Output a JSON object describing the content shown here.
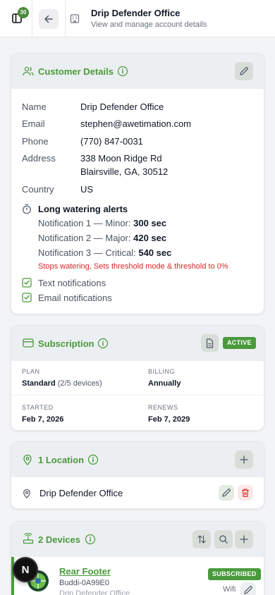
{
  "topbar": {
    "badge_count": "30",
    "title": "Drip Defender Office",
    "subtitle": "View and manage account details"
  },
  "customer": {
    "title": "Customer Details",
    "fields": {
      "name_label": "Name",
      "name_value": "Drip Defender Office",
      "email_label": "Email",
      "email_value": "stephen@awetimation.com",
      "phone_label": "Phone",
      "phone_value": "(770) 847-0031",
      "address_label": "Address",
      "address_line1": "338 Moon Ridge Rd",
      "address_line2": "Blairsville, GA, 30512",
      "country_label": "Country",
      "country_value": "US"
    },
    "alerts": {
      "title": "Long watering alerts",
      "n1_label": "Notification 1 — Minor:",
      "n1_value": "300 sec",
      "n2_label": "Notification 2 — Major:",
      "n2_value": "420 sec",
      "n3_label": "Notification 3 — Critical:",
      "n3_value": "540 sec",
      "warning": "Stops watering, Sets threshold mode & threshold to 0%"
    },
    "text_notifications": "Text notifications",
    "email_notifications": "Email notifications"
  },
  "subscription": {
    "title": "Subscription",
    "status": "ACTIVE",
    "plan_label": "PLAN",
    "plan_value": "Standard",
    "plan_devices": "(2/5 devices)",
    "billing_label": "BILLING",
    "billing_value": "Annually",
    "started_label": "STARTED",
    "started_value": "Feb 7, 2026",
    "renews_label": "RENEWS",
    "renews_value": "Feb 7, 2029"
  },
  "locations": {
    "title": "1 Location",
    "items": [
      {
        "name": "Drip Defender Office"
      }
    ]
  },
  "devices": {
    "title": "2 Devices",
    "items": [
      {
        "name": "Rear Footer",
        "id": "Buddi-0A99E0",
        "location": "Drip Defender Office",
        "status": "SUBSCRIBED",
        "connection": "Wifi"
      }
    ]
  },
  "fab_letter": "N",
  "colors": {
    "accent": "#4a9a3c",
    "danger": "#dc2626",
    "header_bg": "#eceff1"
  }
}
